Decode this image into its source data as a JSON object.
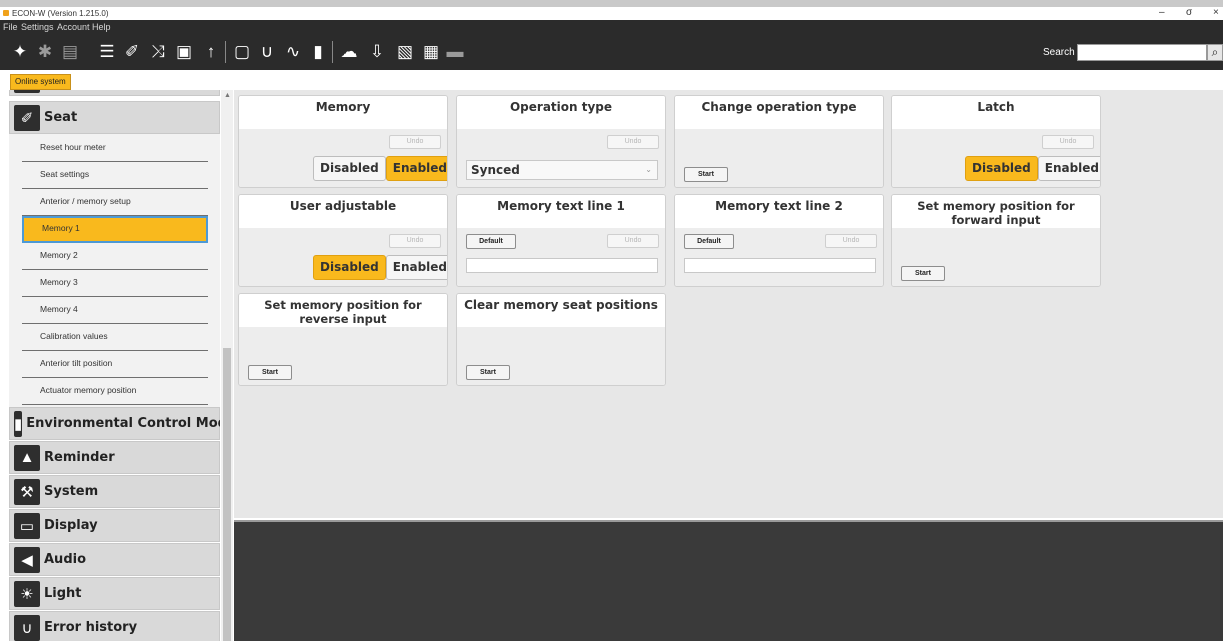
{
  "window": {
    "title": "ECON-W (Version 1.215.0)",
    "minimize": "–",
    "maximize": "σ",
    "close": "×"
  },
  "menu": [
    "File",
    "Settings",
    "Account",
    "Help"
  ],
  "toolbar": {
    "icons": [
      "disconnect-icon",
      "bluetooth-icon",
      "cast-icon",
      "list-icon",
      "seat-tool-icon",
      "shuffle-icon",
      "camera-icon",
      "usb-icon",
      "monitor-icon",
      "stethoscope-icon",
      "pulse-icon",
      "battery-icon",
      "cloud-icon",
      "download-icon",
      "image-icon",
      "clipboard-icon",
      "chat-icon"
    ],
    "search_label": "Search",
    "search_value": ""
  },
  "tab": {
    "label": "Online system"
  },
  "sidebar": {
    "seat_label": "Seat",
    "items": [
      "Reset hour meter",
      "Seat settings",
      "Anterior / memory setup",
      "Memory 1",
      "Memory 2",
      "Memory 3",
      "Memory 4",
      "Calibration values",
      "Anterior tilt position",
      "Actuator memory position"
    ],
    "active_item": "Memory 1",
    "categories": [
      "Environmental Control Module",
      "Reminder",
      "System",
      "Display",
      "Audio",
      "Light",
      "Error history"
    ]
  },
  "cards": {
    "memory": {
      "title": "Memory",
      "undo": "Undo",
      "disabled": "Disabled",
      "enabled": "Enabled",
      "selected": "Enabled"
    },
    "operation_type": {
      "title": "Operation type",
      "undo": "Undo",
      "value": "Synced",
      "caret": "⌄"
    },
    "change_operation_type": {
      "title": "Change operation type",
      "start": "Start"
    },
    "latch": {
      "title": "Latch",
      "undo": "Undo",
      "disabled": "Disabled",
      "enabled": "Enabled",
      "selected": "Disabled"
    },
    "user_adjustable": {
      "title": "User adjustable",
      "undo": "Undo",
      "disabled": "Disabled",
      "enabled": "Enabled",
      "selected": "Disabled"
    },
    "memory_text_1": {
      "title": "Memory text line 1",
      "default": "Default",
      "undo": "Undo",
      "value": ""
    },
    "memory_text_2": {
      "title": "Memory text line 2",
      "default": "Default",
      "undo": "Undo",
      "value": ""
    },
    "set_forward": {
      "title": "Set memory position for forward input",
      "start": "Start"
    },
    "set_reverse": {
      "title": "Set memory position for reverse input",
      "start": "Start"
    },
    "clear_positions": {
      "title": "Clear memory seat positions",
      "start": "Start"
    }
  },
  "colors": {
    "accent": "#f9b91d",
    "toolbar_bg": "#2b2b2b",
    "content_bg": "#e7e7e7"
  }
}
